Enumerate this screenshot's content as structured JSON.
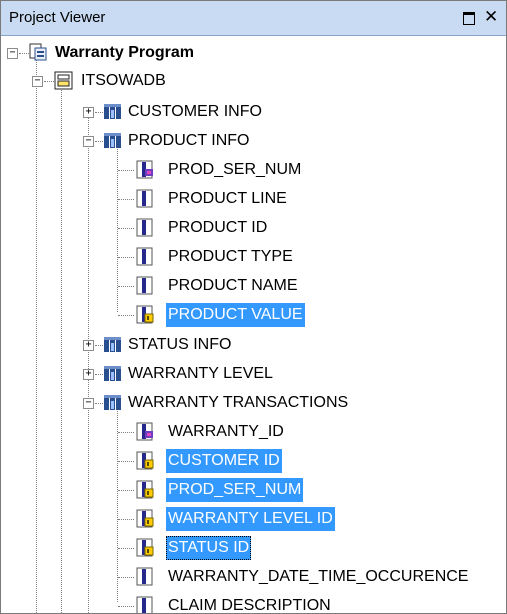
{
  "panel": {
    "title": "Project Viewer",
    "maximize_icon": "maximize-icon",
    "close_glyph": "✕"
  },
  "tree": {
    "root": {
      "label": "Warranty Program",
      "icon": "project-icon",
      "expanded": true
    },
    "database": {
      "label": "ITSOWADB",
      "icon": "database-icon",
      "expanded": true
    },
    "tables": [
      {
        "label": "CUSTOMER INFO",
        "expanded": false
      },
      {
        "label": "PRODUCT INFO",
        "expanded": true
      },
      {
        "label": "STATUS INFO",
        "expanded": false
      },
      {
        "label": "WARRANTY LEVEL",
        "expanded": false
      },
      {
        "label": "WARRANTY TRANSACTIONS",
        "expanded": true
      }
    ],
    "product_info_columns": [
      {
        "label": "PROD_SER_NUM",
        "icon": "key-column-icon",
        "selected": false
      },
      {
        "label": "PRODUCT LINE",
        "icon": "column-icon",
        "selected": false
      },
      {
        "label": "PRODUCT ID",
        "icon": "column-icon",
        "selected": false
      },
      {
        "label": "PRODUCT TYPE",
        "icon": "column-icon",
        "selected": false
      },
      {
        "label": "PRODUCT NAME",
        "icon": "column-icon",
        "selected": false
      },
      {
        "label": "PRODUCT VALUE",
        "icon": "measure-column-icon",
        "selected": true
      }
    ],
    "warranty_transactions_columns": [
      {
        "label": "WARRANTY_ID",
        "icon": "key-column-icon",
        "selected": false
      },
      {
        "label": "CUSTOMER ID",
        "icon": "measure-column-icon",
        "selected": true
      },
      {
        "label": "PROD_SER_NUM",
        "icon": "measure-column-icon",
        "selected": true
      },
      {
        "label": "WARRANTY LEVEL ID",
        "icon": "measure-column-icon",
        "selected": true
      },
      {
        "label": "STATUS ID",
        "icon": "measure-column-icon",
        "selected": true,
        "focused": true
      },
      {
        "label": "WARRANTY_DATE_TIME_OCCURENCE",
        "icon": "column-icon",
        "selected": false
      },
      {
        "label": "CLAIM DESCRIPTION",
        "icon": "column-icon",
        "selected": false
      }
    ]
  },
  "colors": {
    "selection": "#3399ff",
    "titlebar": "#c9dbf2"
  }
}
